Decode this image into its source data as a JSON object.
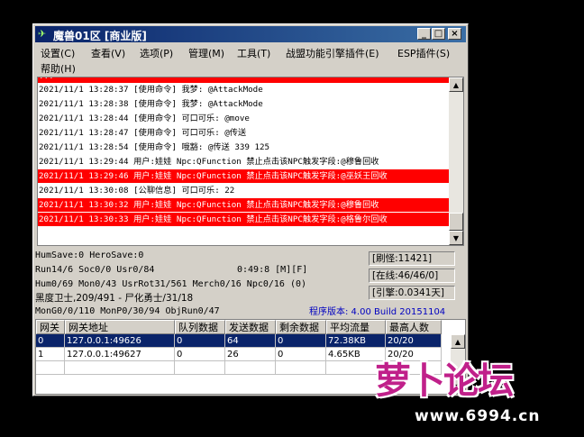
{
  "window": {
    "title": "魔兽01区 [商业版]",
    "controls": {
      "minimize": "_",
      "maximize": "□",
      "close": "×"
    }
  },
  "menu": [
    "设置(C)",
    "查看(V)",
    "选项(P)",
    "管理(M)",
    "工具(T)",
    "战盟功能引擎插件(E)",
    "ESP插件(S)",
    "帮助(H)"
  ],
  "log": {
    "partial_top": "...",
    "lines": [
      {
        "text": "2021/11/1 13:28:37 [使用命令] 我梦: @AttackMode",
        "highlight": false
      },
      {
        "text": "2021/11/1 13:28:38 [使用命令] 我梦: @AttackMode",
        "highlight": false
      },
      {
        "text": "2021/11/1 13:28:44 [使用命令] 可口可乐: @move",
        "highlight": false
      },
      {
        "text": "2021/11/1 13:28:47 [使用命令] 可口可乐: @传送",
        "highlight": false
      },
      {
        "text": "2021/11/1 13:28:54 [使用命令] 哦豁: @传送 339 125",
        "highlight": false
      },
      {
        "text": "2021/11/1 13:29:44 用户:娃娃 Npc:QFunction 禁止点击该NPC触发字段:@穆鲁回收",
        "highlight": false
      },
      {
        "text": "2021/11/1 13:29:46 用户:娃娃 Npc:QFunction 禁止点击该NPC触发字段:@巫妖王回收",
        "highlight": true
      },
      {
        "text": "2021/11/1 13:30:08 [公聊信息] 可口可乐: 22",
        "highlight": false
      },
      {
        "text": "2021/11/1 13:30:32 用户:娃娃 Npc:QFunction 禁止点击该NPC触发字段:@穆鲁回收",
        "highlight": true
      },
      {
        "text": "2021/11/1 13:30:33 用户:娃娃 Npc:QFunction 禁止点击该NPC触发字段:@格鲁尔回收",
        "highlight": true
      }
    ]
  },
  "status": {
    "line1": "HumSave:0 HeroSave:0",
    "line2": "Run14/6 Soc0/0 Usr0/84",
    "timer": "0:49:8 [M][F]",
    "line3": "Hum0/69 Mon0/43 UsrRot31/561 Merch0/16 Npc0/16 (0)",
    "line4": "黑度卫士,209/491 - 尸化勇士/31/18",
    "line5": "MonG0/0/110 MonP0/30/94 ObjRun0/47",
    "refresh": "[刷怪:11421]",
    "online": "[在线:46/46/0]",
    "rebirth": "[引擎:0.0341天]",
    "version": "程序版本: 4.00 Build 20151104"
  },
  "table": {
    "columns": [
      "网关",
      "网关地址",
      "队列数据",
      "发送数据",
      "剩余数据",
      "平均流量",
      "最高人数"
    ],
    "rows": [
      [
        "0",
        "127.0.0.1:49626",
        "0",
        "64",
        "0",
        "72.38KB",
        "20/20"
      ],
      [
        "1",
        "127.0.0.1:49627",
        "0",
        "26",
        "0",
        "4.65KB",
        "20/20"
      ]
    ]
  },
  "watermark": {
    "logo": "萝卜论坛",
    "url": "www.6994.cn"
  },
  "colors": {
    "title_bar": "#0a246a",
    "highlight_row": "#ff0000",
    "selection": "#0a246a",
    "version_text": "#0000c0",
    "watermark": "#c0208a"
  }
}
